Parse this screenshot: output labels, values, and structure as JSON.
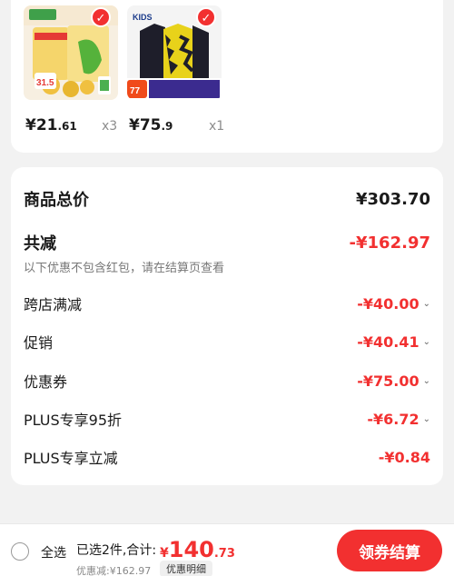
{
  "products": [
    {
      "price_int": "¥21",
      "price_dec": ".61",
      "qty": "x3",
      "badge_text": "31.5"
    },
    {
      "price_int": "¥75",
      "price_dec": ".9",
      "qty": "x1",
      "brand": "KIDS",
      "badge_text": "77"
    }
  ],
  "summary": {
    "total_label": "商品总价",
    "total_value": "¥303.70",
    "reduce_label": "共减",
    "reduce_value": "-¥162.97",
    "note": "以下优惠不包含红包，请在结算页查看",
    "items": [
      {
        "label": "跨店满减",
        "value": "-¥40.00"
      },
      {
        "label": "促销",
        "value": "-¥40.41"
      },
      {
        "label": "优惠券",
        "value": "-¥75.00"
      },
      {
        "label": "PLUS专享95折",
        "value": "-¥6.72"
      },
      {
        "label": "PLUS专享立减",
        "value": "-¥0.84"
      }
    ]
  },
  "bottom": {
    "select_all": "全选",
    "selected_count": "已选2件,合计:",
    "currency": "¥",
    "sum_int": "140",
    "sum_dec": ".73",
    "discount_line": "优惠减:¥162.97",
    "detail_label": "优惠明细",
    "checkout_label": "领券结算"
  },
  "colors": {
    "accent": "#f23030",
    "background": "#f2f2f2"
  },
  "icons": {
    "check": "checkmark-icon",
    "chevron": "chevron-down-icon",
    "radio": "radio-unchecked-icon"
  }
}
